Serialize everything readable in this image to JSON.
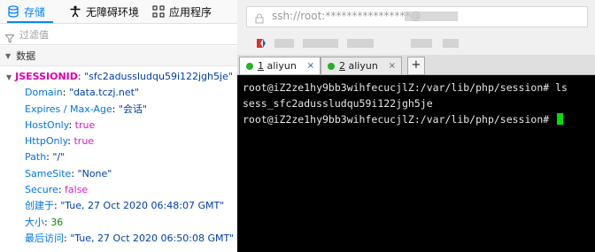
{
  "devtools": {
    "tabs": [
      {
        "label": "存储",
        "icon": "database-icon",
        "active": true
      },
      {
        "label": "无障碍环境",
        "icon": "accessibility-icon",
        "active": false
      },
      {
        "label": "应用程序",
        "icon": "grid-icon",
        "active": false
      }
    ],
    "filter_placeholder": "过滤值",
    "section_title": "数据",
    "cookie": {
      "name": "JSESSIONID",
      "value": "\"sfc2adussludqu59i122jgh5je\"",
      "fields": [
        {
          "key": "Domain",
          "value": "\"data.tczj.net\"",
          "type": "s"
        },
        {
          "key": "Expires / Max-Age",
          "value": "\"会话\"",
          "type": "s"
        },
        {
          "key": "HostOnly",
          "value": "true",
          "type": "b"
        },
        {
          "key": "HttpOnly",
          "value": "true",
          "type": "b"
        },
        {
          "key": "Path",
          "value": "\"/\"",
          "type": "s"
        },
        {
          "key": "SameSite",
          "value": "\"None\"",
          "type": "s"
        },
        {
          "key": "Secure",
          "value": "false",
          "type": "b"
        },
        {
          "key": "创建于",
          "value": "\"Tue, 27 Oct 2020 06:48:07 GMT\"",
          "type": "s"
        },
        {
          "key": "大小",
          "value": "36",
          "type": "n"
        },
        {
          "key": "最后访问",
          "value": "\"Tue, 27 Oct 2020 06:50:08 GMT\"",
          "type": "s"
        }
      ]
    }
  },
  "terminal": {
    "address": "ssh://root:****************@",
    "tabs": [
      {
        "number": "1",
        "label": "aliyun",
        "active": true
      },
      {
        "number": "2",
        "label": "aliyun",
        "active": false
      }
    ],
    "add_tab_label": "+",
    "close_label": "×",
    "lines": [
      "root@iZ2ze1hy9bb3wihfecucjlZ:/var/lib/php/session# ls",
      "sess_sfc2adussludqu59i122jgh5je",
      "root@iZ2ze1hy9bb3wihfecucjlZ:/var/lib/php/session# "
    ],
    "colors": {
      "background": "#000000",
      "text": "#e6e6e6",
      "cursor": "#00e000",
      "tab_dot": "#22b422"
    }
  }
}
